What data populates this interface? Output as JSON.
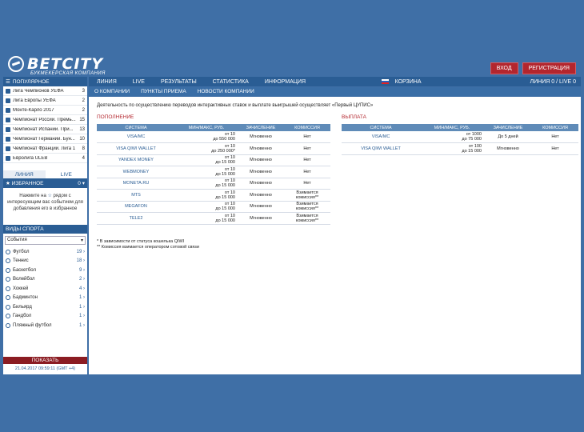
{
  "brand": {
    "name": "BETCITY",
    "tagline": "БУКМЕКЕРСКАЯ КОМПАНИЯ"
  },
  "auth": {
    "login": "ВХОД",
    "register": "РЕГИСТРАЦИЯ"
  },
  "nav": {
    "items": [
      "ЛИНИЯ",
      "LIVE",
      "РЕЗУЛЬТАТЫ",
      "СТАТИСТИКА",
      "ИНФОРМАЦИЯ"
    ],
    "cart": "КОРЗИНА",
    "line_live": "ЛИНИЯ 0 / LIVE 0"
  },
  "subnav": {
    "items": [
      "О КОМПАНИИ",
      "ПУНКТЫ ПРИЕМА",
      "НОВОСТИ КОМПАНИИ"
    ]
  },
  "popular": {
    "title": "ПОПУЛЯРНОЕ",
    "items": [
      {
        "name": "Лига Чемпионов УЕФА",
        "count": "3"
      },
      {
        "name": "Лига Европы УЕФА",
        "count": "2"
      },
      {
        "name": "Монте-Карло 2017",
        "count": "2"
      },
      {
        "name": "Чемпионат России. Премь...",
        "count": "15"
      },
      {
        "name": "Чемпионат Испании. При...",
        "count": "13"
      },
      {
        "name": "Чемпионат Германии. Бун...",
        "count": "10"
      },
      {
        "name": "Чемпионат Франции. Лига 1",
        "count": "8"
      },
      {
        "name": "Евролига ULEB",
        "count": "4"
      }
    ]
  },
  "live_tabs": {
    "line": "ЛИНИЯ",
    "live": "LIVE"
  },
  "favorites": {
    "title": "ИЗБРАННОЕ",
    "count": "0",
    "hint1": "Нажмите на",
    "hint2": "рядом с интересующим вас событием для добавления его в избранное"
  },
  "sports": {
    "title": "ВИДЫ СПОРТА",
    "select": "События",
    "items": [
      {
        "name": "Футбол",
        "count": "19"
      },
      {
        "name": "Теннис",
        "count": "18"
      },
      {
        "name": "Баскетбол",
        "count": "9"
      },
      {
        "name": "Волейбол",
        "count": "2"
      },
      {
        "name": "Хоккей",
        "count": "4"
      },
      {
        "name": "Бадминтон",
        "count": "1"
      },
      {
        "name": "Бильярд",
        "count": "1"
      },
      {
        "name": "Гандбол",
        "count": "1"
      },
      {
        "name": "Пляжный футбол",
        "count": "1"
      }
    ],
    "show": "ПОКАЗАТЬ",
    "timestamp": "21.04.2017 09:59:11 (GMT +4)"
  },
  "main": {
    "intro": "Деятельность по осуществлению переводов интерактивных ставок и выплате выигрышей осуществляет «Первый ЦУПИС»",
    "deposit": {
      "title": "ПОПОЛНЕНИЕ",
      "headers": [
        "СИСТЕМА",
        "МИН/МАКС, РУБ.",
        "ЗАЧИСЛЕНИЕ",
        "КОМИССИЯ"
      ],
      "rows": [
        [
          "VISA/MC",
          "от 10\nдо 550 000",
          "Мгновенно",
          "Нет"
        ],
        [
          "VISA QIWI WALLET",
          "от 10\nдо 250 000*",
          "Мгновенно",
          "Нет"
        ],
        [
          "YANDEX MONEY",
          "от 10\nдо 15 000",
          "Мгновенно",
          "Нет"
        ],
        [
          "WEBMONEY",
          "от 10\nдо 15 000",
          "Мгновенно",
          "Нет"
        ],
        [
          "MONETA.RU",
          "от 10\nдо 15 000",
          "Мгновенно",
          "Нет"
        ],
        [
          "MTS",
          "от 10\nдо 15 000",
          "Мгновенно",
          "Взимается\nкомиссия**"
        ],
        [
          "MEGAFON",
          "от 10\nдо 15 000",
          "Мгновенно",
          "Взимается\nкомиссия**"
        ],
        [
          "TELE2",
          "от 10\nдо 15 000",
          "Мгновенно",
          "Взимается\nкомиссия**"
        ]
      ]
    },
    "withdraw": {
      "title": "ВЫПЛАТА",
      "headers": [
        "СИСТЕМА",
        "МИН/МАКС, РУБ.",
        "ЗАЧИСЛЕНИЕ",
        "КОМИССИЯ"
      ],
      "rows": [
        [
          "VISA/MC",
          "от 1000\nдо 75 000",
          "До 5 дней",
          "Нет"
        ],
        [
          "VISA QIWI WALLET",
          "от 100\nдо 15 000",
          "Мгновенно",
          "Нет"
        ]
      ]
    },
    "notes": [
      "* В зависимости от статуса кошелька QIWI",
      "** Комиссия взимается оператором сотовой связи"
    ]
  }
}
